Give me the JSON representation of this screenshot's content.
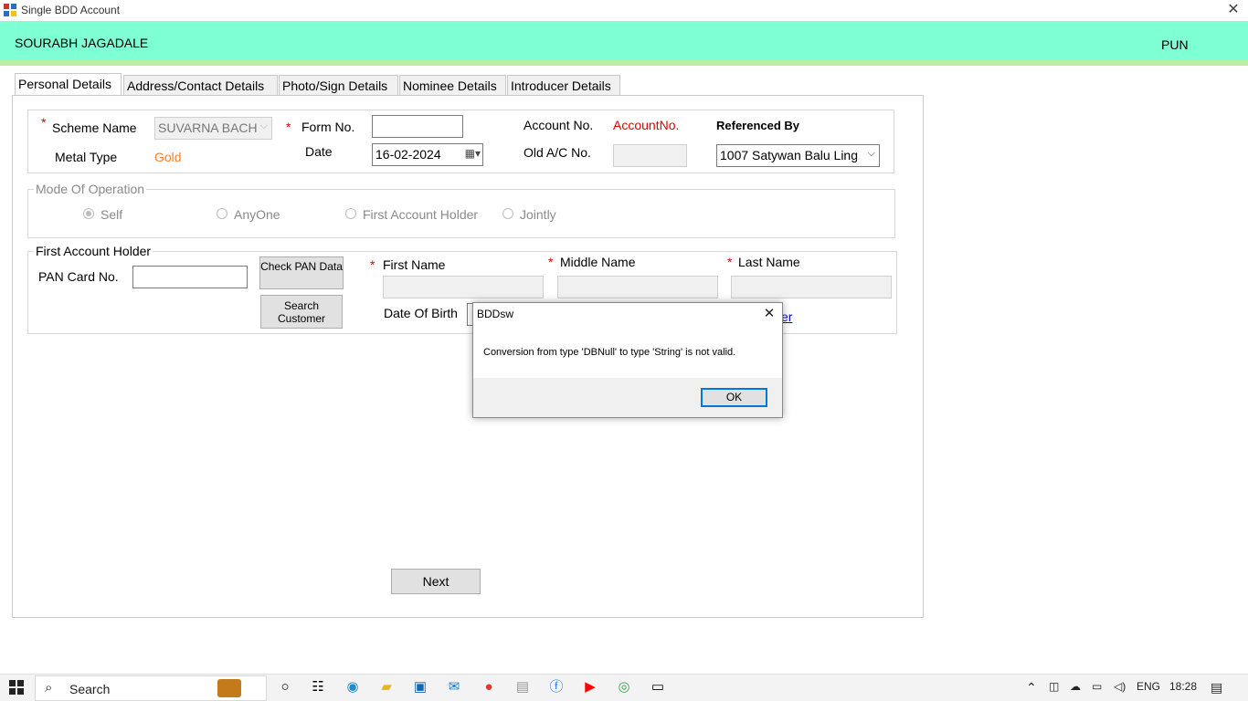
{
  "window": {
    "title": "Single BDD Account",
    "icons": {
      "app": "app-grid-icon",
      "close": "close-icon"
    }
  },
  "header": {
    "user_name": "SOURABH JAGADALE",
    "branch": "PUN",
    "color": "#7fffd4"
  },
  "tabs": [
    {
      "label": "Personal Details",
      "active": true
    },
    {
      "label": "Address/Contact Details"
    },
    {
      "label": "Photo/Sign Details"
    },
    {
      "label": "Nominee Details"
    },
    {
      "label": "Introducer Details"
    }
  ],
  "scheme": {
    "asterisk": "*",
    "scheme_label": "Scheme Name",
    "scheme_value": "SUVARNA BACH",
    "metal_label": "Metal Type",
    "metal_value": "Gold",
    "form_label": "Form No.",
    "form_value": "",
    "date_label": "Date",
    "date_value": "16-02-2024",
    "account_label": "Account No.",
    "account_value": "AccountNo.",
    "old_ac_label": "Old A/C No.",
    "old_ac_value": "",
    "referenced_label": "Referenced By",
    "referenced_value": "1007 Satywan Balu Ling"
  },
  "mode_of_operation": {
    "legend": "Mode Of Operation",
    "options": [
      {
        "label": "Self",
        "checked": true
      },
      {
        "label": "AnyOne",
        "checked": false
      },
      {
        "label": "First Account Holder",
        "checked": false
      },
      {
        "label": "Jointly",
        "checked": false
      }
    ]
  },
  "first_holder": {
    "legend": "First Account Holder",
    "pan_label": "PAN Card No.",
    "pan_value": "",
    "check_pan_button": "Check PAN Data",
    "search_customer_button": "Search Customer",
    "first_name_label": "First Name",
    "middle_name_label": "Middle Name",
    "last_name_label": "Last Name",
    "dob_label": "Date Of Birth",
    "link_fragment": "er"
  },
  "next_button": "Next",
  "dialog": {
    "title": "BDDsw",
    "message": "Conversion from type 'DBNull' to type 'String' is not valid.",
    "ok": "OK"
  },
  "taskbar": {
    "search_placeholder": "Search",
    "language": "ENG",
    "time": "18:28"
  },
  "colors": {
    "required": "#e00000",
    "gold": "#ff7f27",
    "account": "#e00000",
    "link": "#0000ee"
  }
}
